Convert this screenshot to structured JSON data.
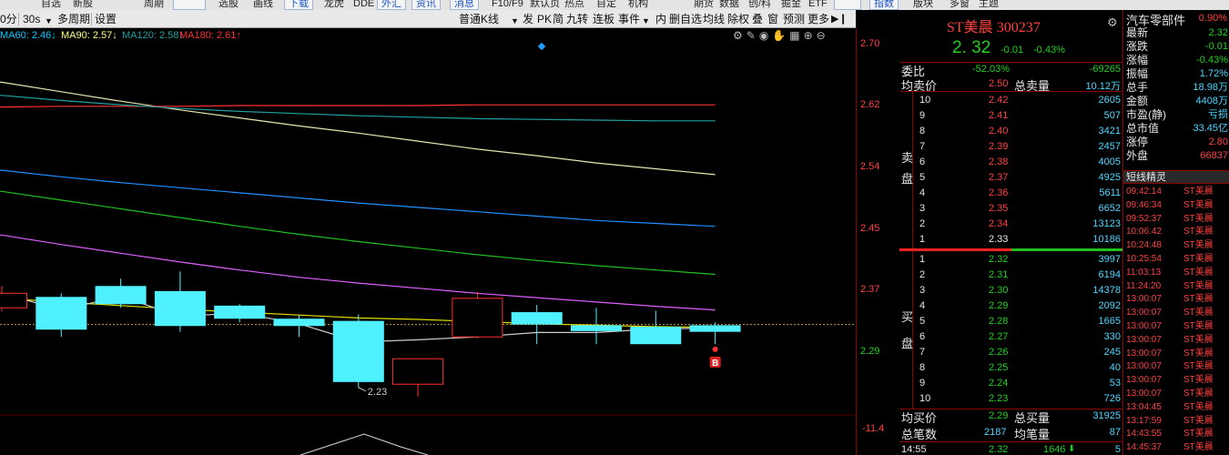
{
  "menubar": {
    "items": [
      "自选",
      "新股",
      "周期",
      "",
      "选股",
      "画线",
      "下载",
      "龙虎",
      "DDE",
      "外汇",
      "资讯",
      "消息",
      "F10/F9",
      "默认页",
      "热点",
      "自定",
      "机构",
      "期货",
      "数据",
      "创/科",
      "掘金",
      "ETF",
      "指数",
      "版块",
      "多窗",
      "主题"
    ]
  },
  "chart_toolbar": {
    "period": "0分",
    "sub_period": "30s",
    "multi_cycle": "多周期",
    "settings": "设置",
    "kline_type": "普通K线",
    "buttons": [
      "发",
      "PK",
      "简",
      "九转",
      "连板",
      "事件",
      "内",
      "删自选",
      "均线",
      "除权",
      "叠",
      "窗",
      "预测",
      "更多"
    ]
  },
  "ma_legend": [
    {
      "text": "MA60: 2.46↓",
      "color": "#00c8ff"
    },
    {
      "text": "MA90: 2.57↓",
      "color": "#ffff80"
    },
    {
      "text": "MA120: 2.58↓",
      "color": "#20a0a0"
    },
    {
      "text": "MA180: 2.61↑",
      "color": "#ff3030"
    }
  ],
  "price_axis": {
    "ticks": [
      "2.70",
      "2.62",
      "2.54",
      "2.45",
      "2.37",
      "2.29"
    ],
    "lower_tick": "-11.4"
  },
  "chart": {
    "low_label": "2.23",
    "b_marker": "B"
  },
  "chart_data": {
    "type": "candlestick",
    "ylim": [
      2.224,
      2.703
    ],
    "candles": [
      {
        "o": 2.34,
        "c": 2.36,
        "h": 2.37,
        "l": 2.335
      },
      {
        "o": 2.355,
        "c": 2.31,
        "h": 2.36,
        "l": 2.3
      },
      {
        "o": 2.37,
        "c": 2.345,
        "h": 2.38,
        "l": 2.34
      },
      {
        "o": 2.363,
        "c": 2.315,
        "h": 2.39,
        "l": 2.307
      },
      {
        "o": 2.343,
        "c": 2.325,
        "h": 2.345,
        "l": 2.32
      },
      {
        "o": 2.325,
        "c": 2.315,
        "h": 2.33,
        "l": 2.3
      },
      {
        "o": 2.322,
        "c": 2.238,
        "h": 2.331,
        "l": 2.23
      },
      {
        "o": 2.235,
        "c": 2.27,
        "h": 2.27,
        "l": 2.218
      },
      {
        "o": 2.3,
        "c": 2.353,
        "h": 2.362,
        "l": 2.298
      },
      {
        "o": 2.334,
        "c": 2.317,
        "h": 2.344,
        "l": 2.29
      },
      {
        "o": 2.316,
        "c": 2.308,
        "h": 2.34,
        "l": 2.29
      },
      {
        "o": 2.314,
        "c": 2.29,
        "h": 2.336,
        "l": 2.29
      },
      {
        "o": 2.316,
        "c": 2.307,
        "h": 2.32,
        "l": 2.29
      }
    ],
    "lines": [
      {
        "color": "#e6e6b0",
        "y": [
          2.65,
          2.637,
          2.624,
          2.612,
          2.601,
          2.59,
          2.58,
          2.569,
          2.558,
          2.549,
          2.539,
          2.531,
          2.523
        ]
      },
      {
        "color": "#ff3030",
        "y": [
          2.616,
          2.617,
          2.617,
          2.617,
          2.618,
          2.618,
          2.618,
          2.618,
          2.619,
          2.619,
          2.619,
          2.619,
          2.619
        ]
      },
      {
        "color": "#20a0a0",
        "y": [
          2.632,
          2.625,
          2.619,
          2.614,
          2.61,
          2.607,
          2.604,
          2.602,
          2.6,
          2.599,
          2.598,
          2.597,
          2.597
        ]
      },
      {
        "color": "#1e90ff",
        "y": [
          2.529,
          2.52,
          2.512,
          2.505,
          2.498,
          2.491,
          2.484,
          2.478,
          2.472,
          2.466,
          2.46,
          2.456,
          2.452
        ]
      },
      {
        "color": "#20c020",
        "y": [
          2.5,
          2.488,
          2.476,
          2.464,
          2.452,
          2.441,
          2.431,
          2.422,
          2.413,
          2.405,
          2.398,
          2.392,
          2.386
        ]
      },
      {
        "color": "#e060ff",
        "y": [
          2.44,
          2.427,
          2.415,
          2.403,
          2.392,
          2.382,
          2.374,
          2.367,
          2.36,
          2.354,
          2.348,
          2.342,
          2.337
        ]
      },
      {
        "color": "#e0e000",
        "y": [
          2.353,
          2.348,
          2.343,
          2.338,
          2.334,
          2.33,
          2.326,
          2.324,
          2.321,
          2.318,
          2.316,
          2.314,
          2.313
        ]
      },
      {
        "color": "#cfcfcf",
        "y": [
          2.36,
          2.337,
          2.356,
          2.328,
          2.333,
          2.318,
          2.293,
          2.296,
          2.3,
          2.306,
          2.306,
          2.311,
          2.312
        ]
      }
    ]
  },
  "quote": {
    "name": "ST美晨",
    "code": "300237",
    "price": "2. 32",
    "change": "-0.01",
    "pct": "-0.43%",
    "weibi_label": "委比",
    "weibi_pct": "-52.03%",
    "weibi_val": "-69265",
    "avg_sell_label": "均卖价",
    "avg_sell": "2.50",
    "total_sell_label": "总卖量",
    "total_sell": "10.12万",
    "sell_side": [
      "卖",
      "盘"
    ],
    "buy_side": [
      "买",
      "盘"
    ],
    "sells": [
      {
        "n": "10",
        "p": "2.42",
        "v": "2605"
      },
      {
        "n": "9",
        "p": "2.41",
        "v": "507"
      },
      {
        "n": "8",
        "p": "2.40",
        "v": "3421"
      },
      {
        "n": "7",
        "p": "2.39",
        "v": "2457"
      },
      {
        "n": "6",
        "p": "2.38",
        "v": "4005"
      },
      {
        "n": "5",
        "p": "2.37",
        "v": "4925"
      },
      {
        "n": "4",
        "p": "2.36",
        "v": "5611"
      },
      {
        "n": "3",
        "p": "2.35",
        "v": "6652"
      },
      {
        "n": "2",
        "p": "2.34",
        "v": "13123"
      },
      {
        "n": "1",
        "p": "2.33",
        "v": "10186"
      }
    ],
    "buys": [
      {
        "n": "1",
        "p": "2.32",
        "v": "3997"
      },
      {
        "n": "2",
        "p": "2.31",
        "v": "6194"
      },
      {
        "n": "3",
        "p": "2.30",
        "v": "14378"
      },
      {
        "n": "4",
        "p": "2.29",
        "v": "2092"
      },
      {
        "n": "5",
        "p": "2.28",
        "v": "1665"
      },
      {
        "n": "6",
        "p": "2.27",
        "v": "330"
      },
      {
        "n": "7",
        "p": "2.26",
        "v": "245"
      },
      {
        "n": "8",
        "p": "2.25",
        "v": "40"
      },
      {
        "n": "9",
        "p": "2.24",
        "v": "53"
      },
      {
        "n": "10",
        "p": "2.23",
        "v": "726"
      }
    ],
    "avg_buy_label": "均买价",
    "avg_buy": "2.29",
    "total_buy_label": "总买量",
    "total_buy": "31925",
    "total_trades_label": "总笔数",
    "total_trades": "2187",
    "avg_trade_label": "均笔量",
    "avg_trade": "87",
    "last_tick": {
      "time": "14:55",
      "price": "2.32",
      "vol": "1646",
      "num": "5"
    }
  },
  "side_panel": {
    "industry": "汽车零部件",
    "industry_pct": "0.90%",
    "stats": [
      {
        "k": "最新",
        "v": "2.32",
        "c": "gn"
      },
      {
        "k": "涨跌",
        "v": "-0.01",
        "c": "gn"
      },
      {
        "k": "涨幅",
        "v": "-0.43%",
        "c": "gn"
      },
      {
        "k": "振幅",
        "v": "1.72%",
        "c": "cy"
      },
      {
        "k": "总手",
        "v": "18.98万",
        "c": "cy"
      },
      {
        "k": "金额",
        "v": "4408万",
        "c": "cy"
      },
      {
        "k": "市盈(静)",
        "v": "亏损",
        "c": "cy"
      },
      {
        "k": "总市值",
        "v": "33.45亿",
        "c": "cy"
      },
      {
        "k": "涨停",
        "v": "2.80",
        "c": "rd"
      },
      {
        "k": "外盘",
        "v": "66837",
        "c": "rd"
      }
    ],
    "alerts_title": "短线精灵",
    "alerts": [
      {
        "t": "09:42:14",
        "n": "ST美晨"
      },
      {
        "t": "09:46:34",
        "n": "ST美晨"
      },
      {
        "t": "09:52:37",
        "n": "ST美晨"
      },
      {
        "t": "10:06:42",
        "n": "ST美晨"
      },
      {
        "t": "10:24:48",
        "n": "ST美晨"
      },
      {
        "t": "10:25:54",
        "n": "ST美晨"
      },
      {
        "t": "11:03:13",
        "n": "ST美晨"
      },
      {
        "t": "11:24:20",
        "n": "ST美晨"
      },
      {
        "t": "13:00:07",
        "n": "ST美晨"
      },
      {
        "t": "13:00:07",
        "n": "ST美晨"
      },
      {
        "t": "13:00:07",
        "n": "ST美晨"
      },
      {
        "t": "13:00:07",
        "n": "ST美晨"
      },
      {
        "t": "13:00:07",
        "n": "ST美晨"
      },
      {
        "t": "13:00:07",
        "n": "ST美晨"
      },
      {
        "t": "13:00:07",
        "n": "ST美晨"
      },
      {
        "t": "13:00:07",
        "n": "ST美晨"
      },
      {
        "t": "13:04:45",
        "n": "ST美晨"
      },
      {
        "t": "13:17:59",
        "n": "ST美晨"
      },
      {
        "t": "14:43:55",
        "n": "ST美晨"
      },
      {
        "t": "14:45:37",
        "n": "ST美晨"
      }
    ]
  }
}
